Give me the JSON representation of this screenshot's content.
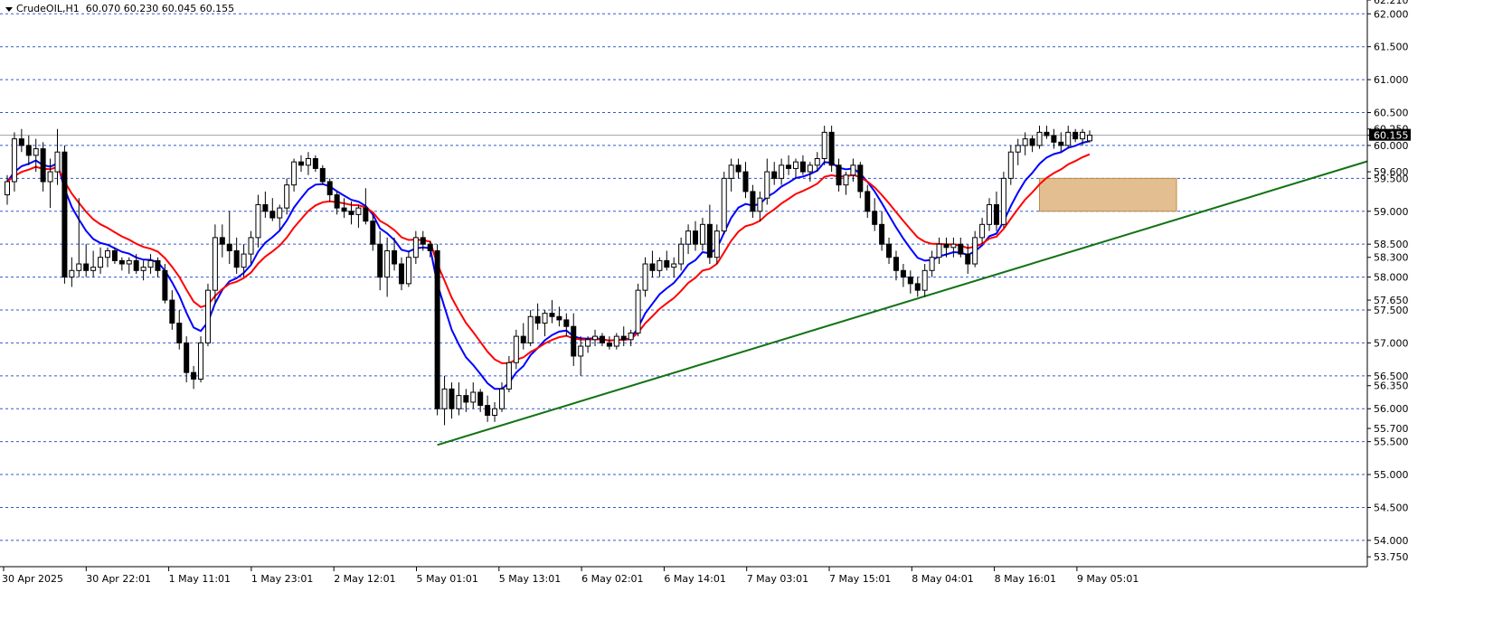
{
  "header": {
    "symbol": "CrudeOIL,H1",
    "ohlc": "60.070 60.230 60.045 60.155"
  },
  "colors": {
    "background": "#ffffff",
    "grid": "#2e5bd3",
    "bull_candle": "#ffffff",
    "bear_candle": "#000000",
    "ma_fast": "#0000ff",
    "ma_slow": "#ff0000",
    "trendline": "#137313",
    "zone": "#d9a86c",
    "price_tag": "#000000"
  },
  "chart_data": {
    "type": "candlestick",
    "timeframe": "H1",
    "ylim": [
      53.6,
      62.21
    ],
    "grid": true,
    "price_axis_labels": [
      "62.210",
      "62.000",
      "61.500",
      "61.000",
      "60.500",
      "60.250",
      "60.155",
      "60.000",
      "59.600",
      "59.500",
      "59.000",
      "58.500",
      "58.300",
      "58.000",
      "57.650",
      "57.500",
      "57.000",
      "56.500",
      "56.350",
      "56.000",
      "55.700",
      "55.500",
      "55.000",
      "54.500",
      "54.000",
      "53.750"
    ],
    "grid_levels": [
      62.0,
      61.5,
      61.0,
      60.5,
      60.0,
      59.5,
      59.0,
      58.5,
      58.0,
      57.5,
      57.0,
      56.5,
      56.0,
      55.5,
      55.0,
      54.5,
      54.0
    ],
    "current_price": 60.155,
    "time_labels": [
      {
        "label": "30 Apr 2025",
        "bar": 0
      },
      {
        "label": "30 Apr 22:01",
        "bar": 20
      },
      {
        "label": "1 May 11:01",
        "bar": 40
      },
      {
        "label": "1 May 23:01",
        "bar": 60
      },
      {
        "label": "2 May 12:01",
        "bar": 80
      },
      {
        "label": "5 May 01:01",
        "bar": 100
      },
      {
        "label": "5 May 13:01",
        "bar": 120
      },
      {
        "label": "6 May 02:01",
        "bar": 140
      },
      {
        "label": "6 May 14:01",
        "bar": 160
      },
      {
        "label": "7 May 03:01",
        "bar": 180
      },
      {
        "label": "7 May 15:01",
        "bar": 200
      },
      {
        "label": "8 May 04:01",
        "bar": 220
      },
      {
        "label": "8 May 16:01",
        "bar": 240
      },
      {
        "label": "9 May 05:01",
        "bar": 260
      }
    ],
    "candles": [
      [
        59.25,
        59.55,
        59.1,
        59.45
      ],
      [
        59.45,
        60.2,
        59.3,
        60.1
      ],
      [
        60.1,
        60.25,
        59.9,
        60.0
      ],
      [
        60.0,
        60.15,
        59.7,
        59.85
      ],
      [
        59.85,
        60.1,
        59.6,
        59.95
      ],
      [
        59.95,
        60.05,
        59.3,
        59.45
      ],
      [
        59.45,
        59.8,
        59.05,
        59.6
      ],
      [
        59.6,
        60.25,
        59.4,
        59.9
      ],
      [
        59.9,
        60.0,
        57.9,
        58.0
      ],
      [
        58.0,
        58.3,
        57.85,
        58.1
      ],
      [
        58.1,
        59.2,
        58.0,
        58.2
      ],
      [
        58.2,
        58.5,
        58.0,
        58.1
      ],
      [
        58.1,
        58.4,
        58.0,
        58.15
      ],
      [
        58.15,
        58.45,
        58.05,
        58.3
      ],
      [
        58.3,
        58.45,
        58.15,
        58.4
      ],
      [
        58.4,
        58.45,
        58.2,
        58.25
      ],
      [
        58.25,
        58.3,
        58.1,
        58.2
      ],
      [
        58.2,
        58.3,
        58.05,
        58.25
      ],
      [
        58.25,
        58.35,
        58.05,
        58.1
      ],
      [
        58.1,
        58.25,
        57.95,
        58.15
      ],
      [
        58.15,
        58.35,
        58.05,
        58.25
      ],
      [
        58.25,
        58.3,
        58.0,
        58.1
      ],
      [
        58.1,
        58.2,
        57.6,
        57.65
      ],
      [
        57.65,
        57.8,
        57.2,
        57.3
      ],
      [
        57.3,
        57.5,
        56.9,
        57.0
      ],
      [
        57.0,
        57.1,
        56.4,
        56.55
      ],
      [
        56.55,
        56.65,
        56.3,
        56.45
      ],
      [
        56.45,
        57.1,
        56.4,
        57.0
      ],
      [
        57.0,
        57.9,
        56.95,
        57.8
      ],
      [
        57.8,
        58.8,
        57.6,
        58.6
      ],
      [
        58.6,
        58.8,
        58.3,
        58.5
      ],
      [
        58.5,
        59.0,
        58.2,
        58.4
      ],
      [
        58.4,
        58.6,
        58.05,
        58.15
      ],
      [
        58.15,
        58.5,
        58.0,
        58.35
      ],
      [
        58.35,
        58.7,
        58.2,
        58.6
      ],
      [
        58.6,
        59.25,
        58.45,
        59.1
      ],
      [
        59.1,
        59.3,
        58.9,
        59.0
      ],
      [
        59.0,
        59.2,
        58.85,
        58.9
      ],
      [
        58.9,
        59.1,
        58.7,
        59.05
      ],
      [
        59.05,
        59.5,
        58.95,
        59.4
      ],
      [
        59.4,
        59.8,
        59.3,
        59.75
      ],
      [
        59.75,
        59.85,
        59.6,
        59.7
      ],
      [
        59.7,
        59.9,
        59.55,
        59.8
      ],
      [
        59.8,
        59.85,
        59.6,
        59.65
      ],
      [
        59.65,
        59.7,
        59.4,
        59.45
      ],
      [
        59.45,
        59.5,
        59.15,
        59.25
      ],
      [
        59.25,
        59.3,
        58.95,
        59.05
      ],
      [
        59.05,
        59.2,
        58.9,
        59.0
      ],
      [
        59.0,
        59.15,
        58.8,
        58.95
      ],
      [
        58.95,
        59.1,
        58.75,
        59.05
      ],
      [
        59.05,
        59.35,
        58.8,
        58.85
      ],
      [
        58.85,
        58.95,
        58.4,
        58.5
      ],
      [
        58.5,
        58.7,
        57.8,
        58.0
      ],
      [
        58.0,
        58.6,
        57.7,
        58.4
      ],
      [
        58.4,
        58.6,
        58.1,
        58.2
      ],
      [
        58.2,
        58.3,
        57.8,
        57.9
      ],
      [
        57.9,
        58.4,
        57.85,
        58.3
      ],
      [
        58.3,
        58.7,
        58.2,
        58.6
      ],
      [
        58.6,
        58.7,
        58.4,
        58.5
      ],
      [
        58.5,
        58.55,
        58.3,
        58.4
      ],
      [
        58.4,
        58.5,
        55.9,
        56.0
      ],
      [
        56.0,
        56.5,
        55.75,
        56.3
      ],
      [
        56.3,
        56.4,
        55.85,
        56.0
      ],
      [
        56.0,
        56.4,
        55.9,
        56.2
      ],
      [
        56.2,
        56.3,
        55.95,
        56.1
      ],
      [
        56.1,
        56.4,
        56.0,
        56.25
      ],
      [
        56.25,
        56.3,
        55.95,
        56.05
      ],
      [
        56.05,
        56.2,
        55.8,
        55.9
      ],
      [
        55.9,
        56.1,
        55.8,
        56.0
      ],
      [
        56.0,
        56.4,
        55.95,
        56.3
      ],
      [
        56.3,
        56.8,
        56.25,
        56.7
      ],
      [
        56.7,
        57.2,
        56.6,
        57.1
      ],
      [
        57.1,
        57.3,
        56.9,
        57.0
      ],
      [
        57.0,
        57.5,
        56.95,
        57.4
      ],
      [
        57.4,
        57.6,
        57.2,
        57.3
      ],
      [
        57.3,
        57.5,
        57.1,
        57.45
      ],
      [
        57.45,
        57.65,
        57.3,
        57.4
      ],
      [
        57.4,
        57.55,
        57.25,
        57.35
      ],
      [
        57.35,
        57.45,
        57.1,
        57.25
      ],
      [
        57.25,
        57.45,
        56.65,
        56.8
      ],
      [
        56.8,
        57.1,
        56.5,
        56.95
      ],
      [
        56.95,
        57.1,
        56.85,
        57.05
      ],
      [
        57.05,
        57.2,
        56.95,
        57.1
      ],
      [
        57.1,
        57.15,
        56.95,
        57.0
      ],
      [
        57.0,
        57.1,
        56.9,
        56.95
      ],
      [
        56.95,
        57.15,
        56.9,
        57.1
      ],
      [
        57.1,
        57.25,
        56.95,
        57.05
      ],
      [
        57.05,
        57.2,
        56.95,
        57.15
      ],
      [
        57.15,
        57.9,
        57.1,
        57.8
      ],
      [
        57.8,
        58.3,
        57.7,
        58.2
      ],
      [
        58.2,
        58.4,
        58.0,
        58.1
      ],
      [
        58.1,
        58.3,
        58.0,
        58.25
      ],
      [
        58.25,
        58.4,
        58.1,
        58.15
      ],
      [
        58.15,
        58.3,
        58.0,
        58.2
      ],
      [
        58.2,
        58.6,
        58.1,
        58.5
      ],
      [
        58.5,
        58.8,
        58.35,
        58.7
      ],
      [
        58.7,
        58.85,
        58.4,
        58.5
      ],
      [
        58.5,
        58.9,
        58.4,
        58.8
      ],
      [
        58.8,
        59.1,
        58.2,
        58.3
      ],
      [
        58.3,
        58.8,
        58.2,
        58.7
      ],
      [
        58.7,
        59.6,
        58.65,
        59.5
      ],
      [
        59.5,
        59.8,
        59.3,
        59.7
      ],
      [
        59.7,
        59.8,
        59.5,
        59.6
      ],
      [
        59.6,
        59.75,
        59.2,
        59.3
      ],
      [
        59.3,
        59.4,
        58.9,
        59.0
      ],
      [
        59.0,
        59.3,
        58.85,
        59.2
      ],
      [
        59.2,
        59.8,
        59.1,
        59.6
      ],
      [
        59.6,
        59.75,
        59.4,
        59.5
      ],
      [
        59.5,
        59.8,
        59.4,
        59.7
      ],
      [
        59.7,
        59.85,
        59.55,
        59.65
      ],
      [
        59.65,
        59.8,
        59.5,
        59.75
      ],
      [
        59.75,
        59.85,
        59.55,
        59.6
      ],
      [
        59.6,
        59.75,
        59.45,
        59.7
      ],
      [
        59.7,
        59.9,
        59.6,
        59.8
      ],
      [
        59.8,
        60.3,
        59.7,
        60.2
      ],
      [
        60.2,
        60.3,
        59.6,
        59.7
      ],
      [
        59.7,
        59.8,
        59.3,
        59.4
      ],
      [
        59.4,
        59.6,
        59.25,
        59.55
      ],
      [
        59.55,
        59.8,
        59.45,
        59.7
      ],
      [
        59.7,
        59.75,
        59.2,
        59.3
      ],
      [
        59.3,
        59.4,
        58.9,
        59.0
      ],
      [
        59.0,
        59.2,
        58.7,
        58.8
      ],
      [
        58.8,
        59.0,
        58.4,
        58.5
      ],
      [
        58.5,
        58.6,
        58.2,
        58.3
      ],
      [
        58.3,
        58.4,
        57.95,
        58.1
      ],
      [
        58.1,
        58.2,
        57.85,
        58.0
      ],
      [
        58.0,
        58.1,
        57.75,
        57.9
      ],
      [
        57.9,
        58.0,
        57.7,
        57.8
      ],
      [
        57.8,
        58.2,
        57.7,
        58.1
      ],
      [
        58.1,
        58.4,
        58.0,
        58.3
      ],
      [
        58.3,
        58.6,
        58.2,
        58.5
      ],
      [
        58.5,
        58.6,
        58.3,
        58.45
      ],
      [
        58.45,
        58.6,
        58.3,
        58.5
      ],
      [
        58.5,
        58.6,
        58.3,
        58.35
      ],
      [
        58.35,
        58.5,
        58.05,
        58.2
      ],
      [
        58.2,
        58.7,
        58.15,
        58.6
      ],
      [
        58.6,
        58.9,
        58.5,
        58.8
      ],
      [
        58.8,
        59.2,
        58.7,
        59.1
      ],
      [
        59.1,
        59.3,
        58.7,
        58.8
      ],
      [
        58.8,
        59.6,
        58.75,
        59.5
      ],
      [
        59.5,
        60.0,
        59.4,
        59.9
      ],
      [
        59.9,
        60.1,
        59.7,
        60.0
      ],
      [
        60.0,
        60.2,
        59.85,
        60.1
      ],
      [
        60.1,
        60.15,
        59.9,
        60.0
      ],
      [
        60.0,
        60.3,
        59.95,
        60.2
      ],
      [
        60.2,
        60.3,
        60.1,
        60.15
      ],
      [
        60.15,
        60.25,
        59.95,
        60.05
      ],
      [
        60.05,
        60.2,
        59.9,
        60.0
      ],
      [
        60.0,
        60.3,
        59.95,
        60.2
      ],
      [
        60.2,
        60.25,
        60.05,
        60.1
      ],
      [
        60.1,
        60.25,
        60.0,
        60.2
      ],
      [
        60.07,
        60.23,
        60.045,
        60.155
      ]
    ],
    "ma_fast_end": 59.8,
    "ma_slow_end": 59.55,
    "trendline": {
      "start_bar": 60,
      "start_price": 55.45,
      "end_bar": 200,
      "end_price": 60.1
    },
    "zone": {
      "start_bar": 144,
      "end_bar": 170,
      "top": 59.5,
      "bottom": 59.0
    }
  }
}
